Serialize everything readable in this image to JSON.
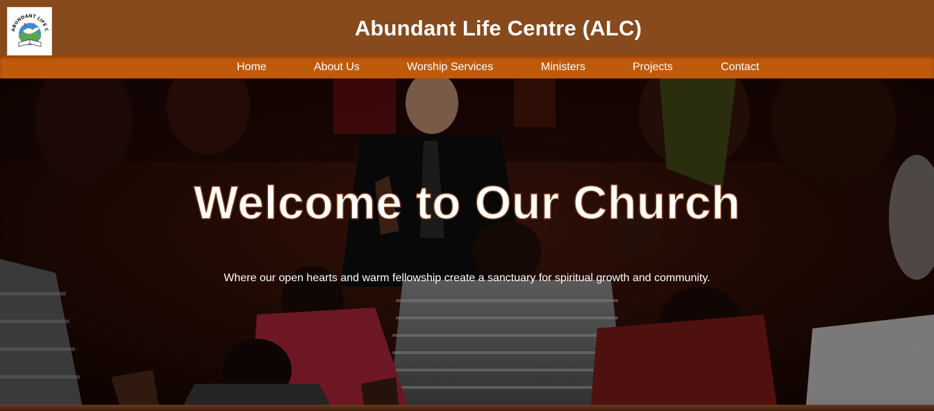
{
  "header": {
    "title": "Abundant Life Centre (ALC)",
    "logo": {
      "text": "ABUNDANT LIFE CENTRE",
      "icon": "dove-bible-logo"
    },
    "background_color": "#874a1c"
  },
  "nav": {
    "background_color": "#c05a0b",
    "items": [
      {
        "label": "Home"
      },
      {
        "label": "About Us"
      },
      {
        "label": "Worship Services"
      },
      {
        "label": "Ministers"
      },
      {
        "label": "Projects"
      },
      {
        "label": "Contact"
      }
    ]
  },
  "hero": {
    "title": "Welcome to Our Church",
    "subtitle": "Where our open hearts and warm fellowship create a sanctuary for spiritual growth and community.",
    "image": "worship-congregation-photo"
  }
}
